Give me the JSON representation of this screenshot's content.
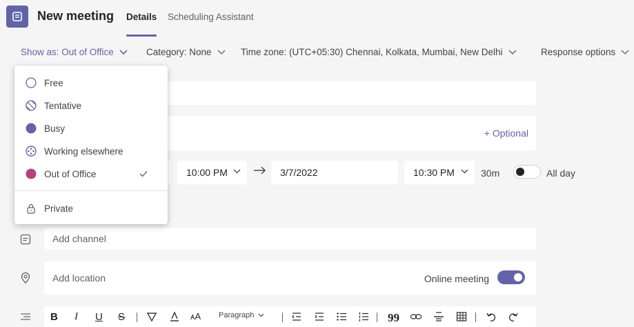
{
  "header": {
    "title": "New meeting",
    "tabs": [
      {
        "label": "Details",
        "active": true
      },
      {
        "label": "Scheduling Assistant",
        "active": false
      }
    ]
  },
  "toolbar": {
    "show_as": "Show as: Out of Office",
    "category": "Category: None",
    "time_zone": "Time zone: (UTC+05:30) Chennai, Kolkata, Mumbai, New Delhi",
    "response_options": "Response options"
  },
  "form": {
    "attendees_optional": "+ Optional",
    "start_time": "10:00 PM",
    "end_date": "3/7/2022",
    "end_time": "10:30 PM",
    "duration": "30m",
    "all_day_label": "All day",
    "channel_placeholder": "Add channel",
    "location_placeholder": "Add location",
    "online_meeting_label": "Online meeting",
    "online_meeting_enabled": true
  },
  "editor": {
    "paragraph_label": "Paragraph"
  },
  "show_as_menu": {
    "items": [
      {
        "label": "Free",
        "icon": "free-status-icon",
        "color": "#ffffff"
      },
      {
        "label": "Tentative",
        "icon": "tentative-status-icon",
        "color": "#6264a7"
      },
      {
        "label": "Busy",
        "icon": "busy-status-icon",
        "color": "#6264a7"
      },
      {
        "label": "Working elsewhere",
        "icon": "working-elsewhere-status-icon",
        "color": "#6264a7"
      },
      {
        "label": "Out of Office",
        "icon": "out-of-office-status-icon",
        "color": "#b4437b",
        "selected": true
      }
    ],
    "private_label": "Private"
  },
  "colors": {
    "accent": "#6264a7",
    "out_of_office": "#b4437b"
  }
}
